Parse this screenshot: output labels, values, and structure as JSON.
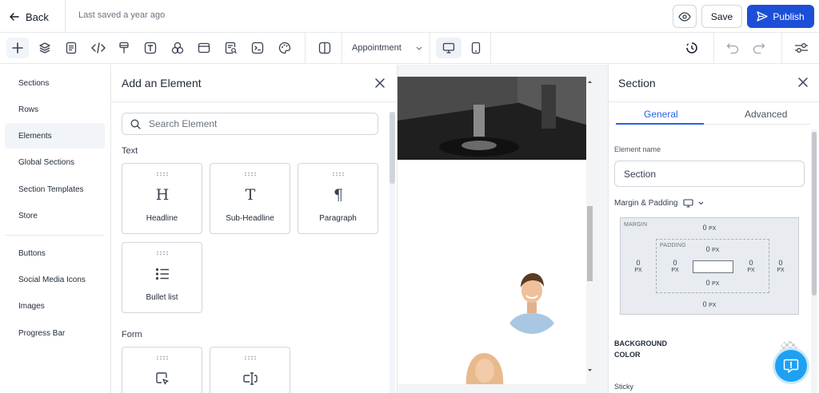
{
  "topbar": {
    "back_label": "Back",
    "saved_text": "Last saved a year ago",
    "save_label": "Save",
    "publish_label": "Publish",
    "publish_color": "#1d4ed8"
  },
  "toolbar": {
    "template_selected": "Appointment",
    "icons": [
      "add-icon",
      "layers-icon",
      "page-icon",
      "code-icon",
      "paint-brush-icon",
      "text-icon",
      "shapes-icon",
      "layout-icon",
      "search-document-icon",
      "terminal-icon",
      "palette-icon",
      "panel-split-icon",
      "desktop-icon",
      "mobile-icon",
      "history-icon",
      "undo-icon",
      "redo-icon",
      "settings-sliders-icon"
    ]
  },
  "leftnav": {
    "items": [
      {
        "label": "Sections"
      },
      {
        "label": "Rows"
      },
      {
        "label": "Elements"
      },
      {
        "label": "Global Sections"
      },
      {
        "label": "Section Templates"
      },
      {
        "label": "Store"
      },
      {
        "label": "Buttons"
      },
      {
        "label": "Social Media Icons"
      },
      {
        "label": "Images"
      },
      {
        "label": "Progress Bar"
      }
    ],
    "active": "Elements"
  },
  "element_panel": {
    "title": "Add an Element",
    "search_placeholder": "Search Element",
    "text_section": "Text",
    "text_elements": [
      {
        "label": "Headline",
        "glyph": "H"
      },
      {
        "label": "Sub-Headline",
        "glyph": "T"
      },
      {
        "label": "Paragraph",
        "glyph": "¶"
      },
      {
        "label": "Bullet list",
        "glyph": "☰"
      }
    ],
    "form_section": "Form"
  },
  "right_panel": {
    "title": "Section",
    "tabs": [
      "General",
      "Advanced"
    ],
    "active_tab": "General",
    "element_name_label": "Element name",
    "element_name_value": "Section",
    "margin_padding_label": "Margin & Padding",
    "margin_label": "MARGIN",
    "padding_label": "PADDING",
    "margin": {
      "top": "0",
      "right": "0",
      "bottom": "0",
      "left": "0"
    },
    "padding": {
      "top": "0",
      "right": "0",
      "bottom": "0",
      "left": "0"
    },
    "unit": "PX",
    "background_label": "BACKGROUND COLOR",
    "sticky_label": "Sticky"
  }
}
